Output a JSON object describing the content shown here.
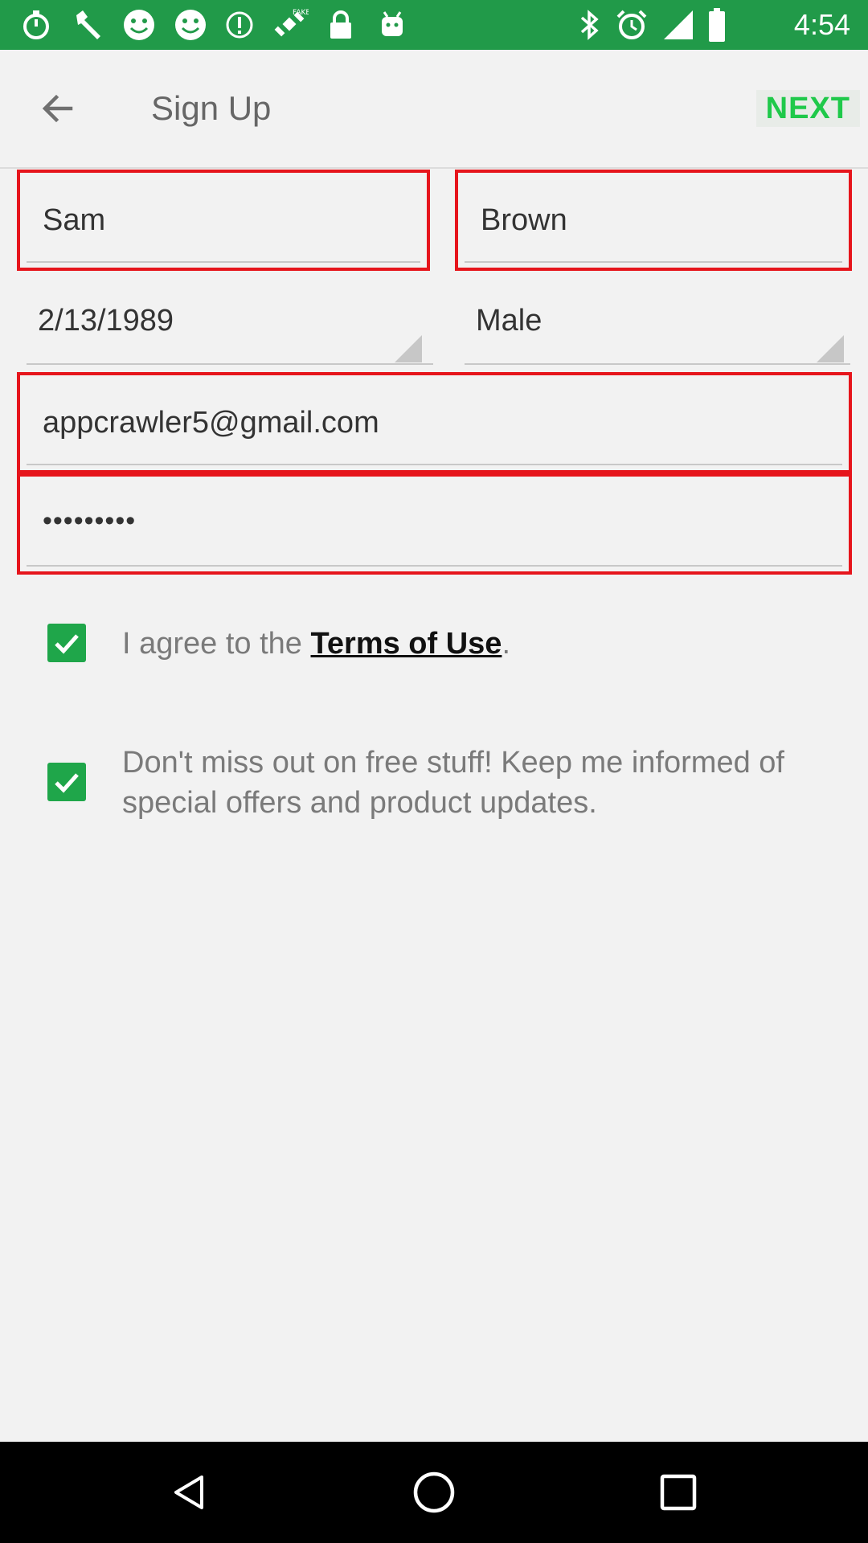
{
  "status_bar": {
    "time": "4:54",
    "left_icons": [
      "stopwatch-icon",
      "wrench-icon",
      "smiley-icon",
      "smiley-icon",
      "info-circle-icon",
      "satellite-fake-gps-icon",
      "lock-icon",
      "android-icon"
    ],
    "right_icons": [
      "bluetooth-icon",
      "alarm-icon",
      "signal-icon",
      "battery-icon"
    ],
    "background_color": "#219a49"
  },
  "app_bar": {
    "title": "Sign Up",
    "next_label": "NEXT",
    "accent_color": "#1fc94a"
  },
  "form": {
    "first_name": "Sam",
    "last_name": "Brown",
    "birth_date": "2/13/1989",
    "gender": "Male",
    "email": "appcrawler5@gmail.com",
    "password": "•••••••••",
    "highlight_color": "#e6151c"
  },
  "agreements": {
    "terms_prefix": "I agree to the ",
    "terms_link": "Terms of Use",
    "terms_suffix": ".",
    "terms_checked": true,
    "offers_text": "Don't miss out on free stuff! Keep me informed of special offers and product updates.",
    "offers_checked": true,
    "checkbox_color": "#1fa64a"
  },
  "nav_bar": {
    "buttons": [
      "back-triangle-icon",
      "home-circle-icon",
      "recents-square-icon"
    ]
  }
}
